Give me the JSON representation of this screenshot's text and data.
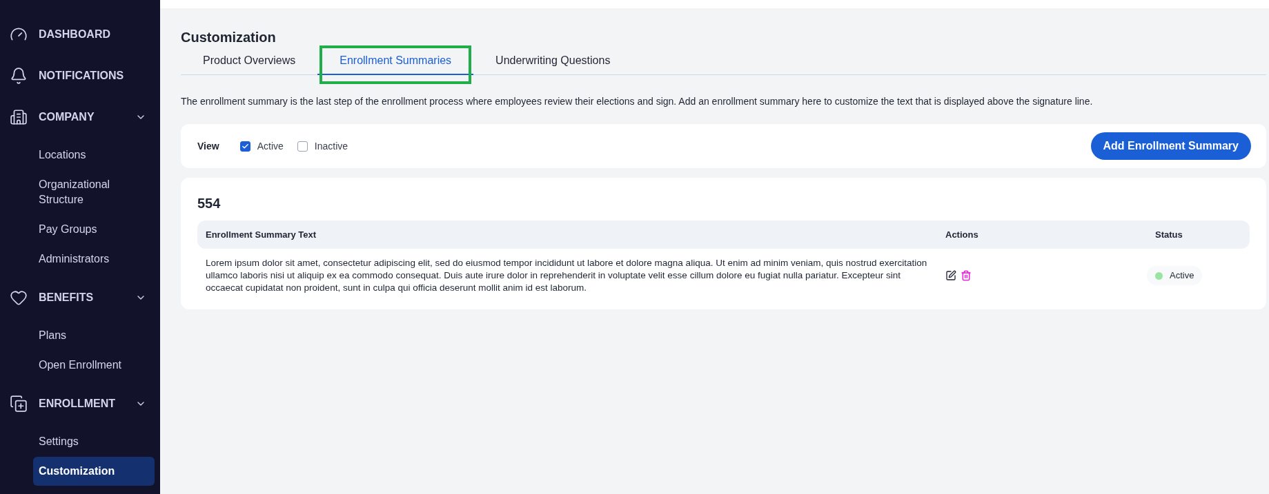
{
  "sidebar": {
    "sections": [
      {
        "label": "DASHBOARD"
      },
      {
        "label": "NOTIFICATIONS"
      },
      {
        "label": "COMPANY",
        "expanded": true,
        "children": [
          {
            "label": "Locations",
            "selected": false
          },
          {
            "label": "Organizational Structure",
            "selected": false
          },
          {
            "label": "Pay Groups",
            "selected": false
          },
          {
            "label": "Administrators",
            "selected": false
          }
        ]
      },
      {
        "label": "BENEFITS",
        "expanded": true,
        "children": [
          {
            "label": "Plans",
            "selected": false
          },
          {
            "label": "Open Enrollment",
            "selected": false
          }
        ]
      },
      {
        "label": "ENROLLMENT",
        "expanded": true,
        "children": [
          {
            "label": "Settings",
            "selected": false
          },
          {
            "label": "Customization",
            "selected": true
          }
        ]
      }
    ]
  },
  "page": {
    "title": "Customization",
    "tabs": [
      {
        "label": "Product Overviews",
        "selected": false,
        "highlighted": false
      },
      {
        "label": "Enrollment Summaries",
        "selected": true,
        "highlighted": true
      },
      {
        "label": "Underwriting Questions",
        "selected": false,
        "highlighted": false
      }
    ],
    "description": "The enrollment summary is the last step of the enrollment process where employees review their elections and sign. Add an enrollment summary here to customize the text that is displayed above the signature line.",
    "filter": {
      "label": "View",
      "options": [
        {
          "label": "Active",
          "checked": true
        },
        {
          "label": "Inactive",
          "checked": false
        }
      ]
    },
    "add_button": "Add Enrollment Summary",
    "group": {
      "title": "554",
      "table": {
        "columns": [
          "Enrollment Summary Text",
          "Actions",
          "Status"
        ],
        "rows": [
          {
            "text": "Lorem ipsum dolor sit amet, consectetur adipiscing elit, sed do eiusmod tempor incididunt ut labore et dolore magna aliqua. Ut enim ad minim veniam, quis nostrud exercitation ullamco laboris nisi ut aliquip ex ea commodo consequat. Duis aute irure dolor in reprehenderit in voluptate velit esse cillum dolore eu fugiat nulla pariatur. Excepteur sint occaecat cupidatat non proident, sunt in culpa qui officia deserunt mollit anim id est laborum.",
            "status": {
              "label": "Active",
              "color": "#9be3a0"
            }
          }
        ]
      }
    }
  }
}
